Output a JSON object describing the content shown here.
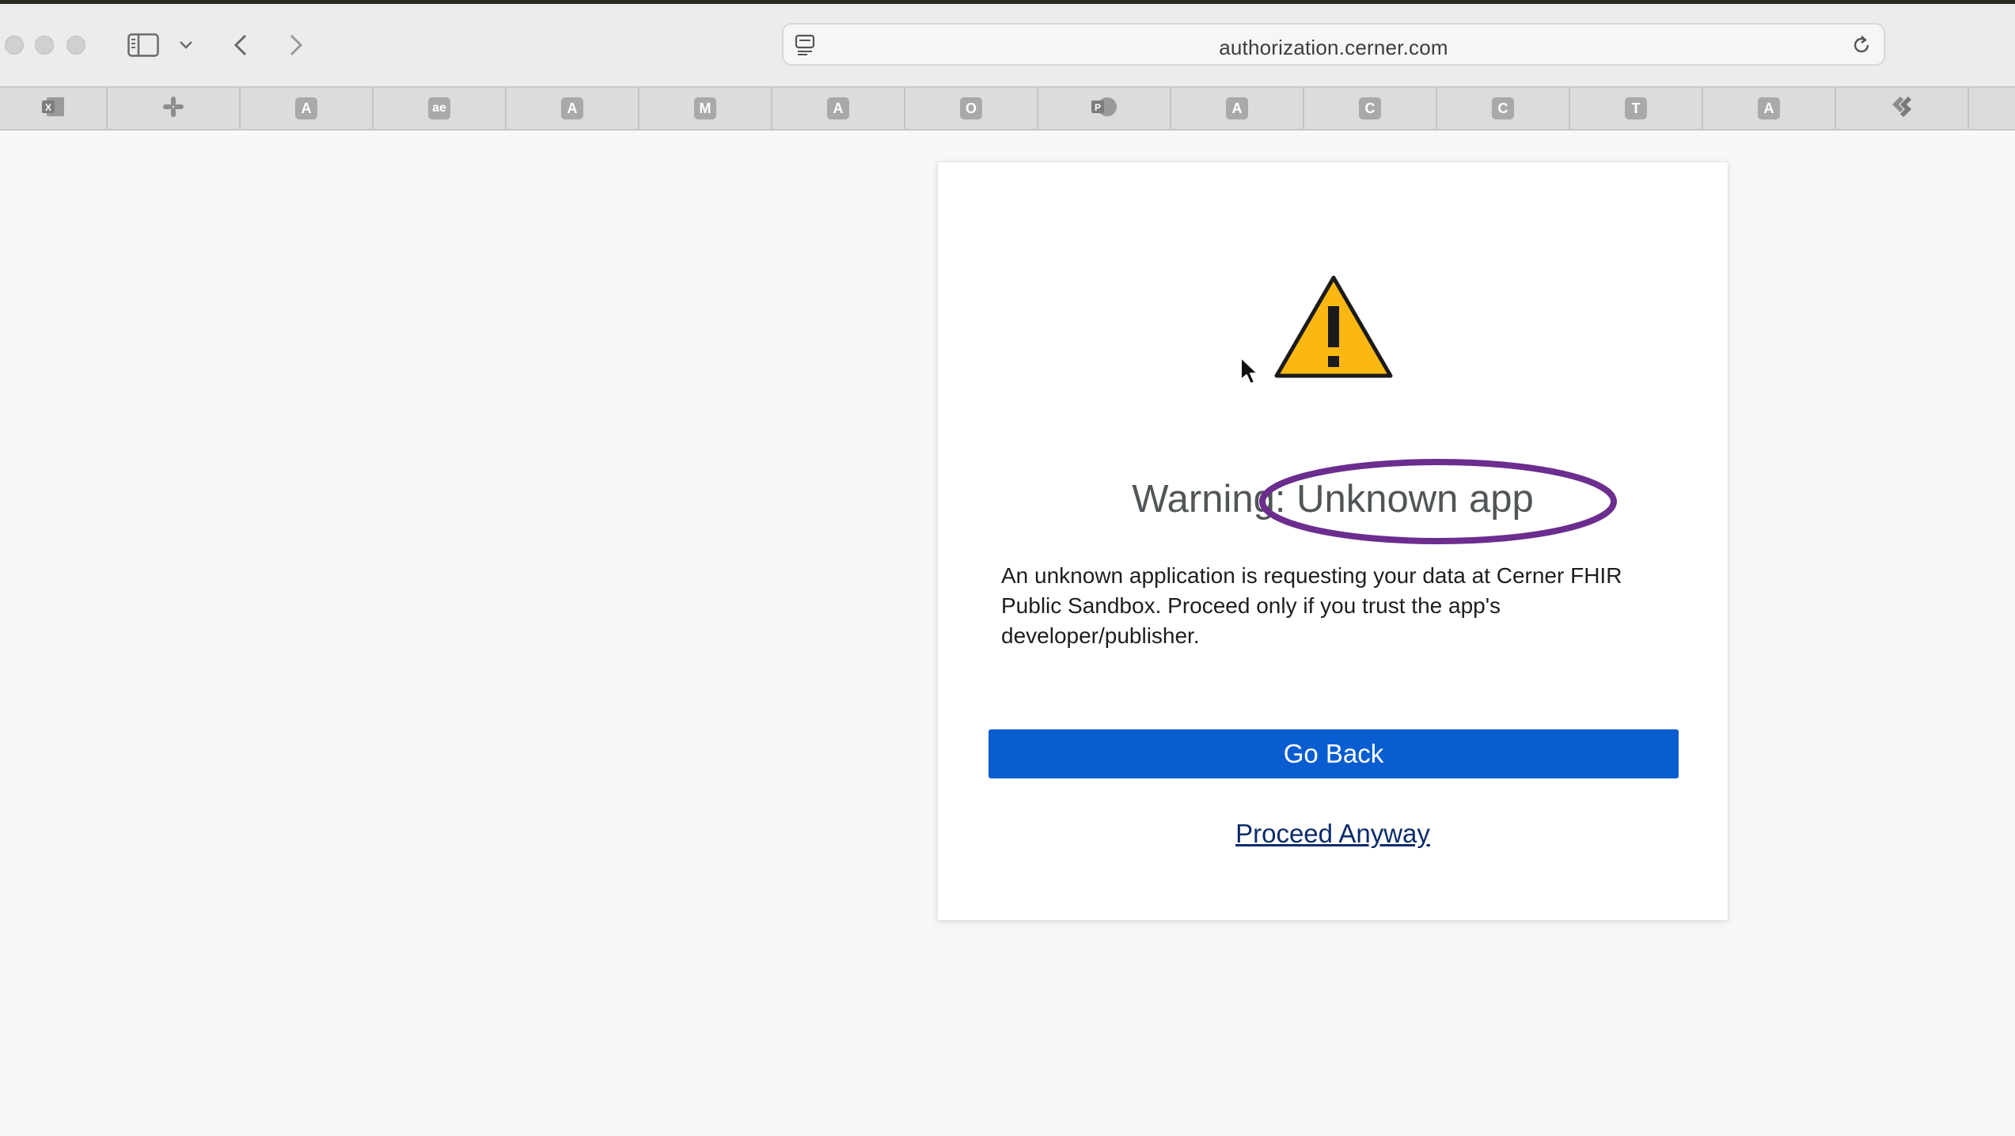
{
  "browser": {
    "url": "authorization.cerner.com",
    "icons": {
      "sidebar": "sidebar-icon",
      "dropdown": "chevron-down-icon",
      "back": "chevron-left-icon",
      "forward": "chevron-right-icon",
      "page_menu": "page-menu-icon",
      "reload": "reload-icon"
    }
  },
  "tabs": [
    {
      "letter": "",
      "icon": "excel-icon"
    },
    {
      "letter": "",
      "icon": "slack-icon"
    },
    {
      "letter": "A"
    },
    {
      "letter": "ae"
    },
    {
      "letter": "A"
    },
    {
      "letter": "M"
    },
    {
      "letter": "A"
    },
    {
      "letter": "O"
    },
    {
      "letter": "",
      "icon": "powerpoint-icon"
    },
    {
      "letter": "A"
    },
    {
      "letter": "C"
    },
    {
      "letter": "C"
    },
    {
      "letter": "T"
    },
    {
      "letter": "A"
    },
    {
      "letter": "",
      "icon": "jira-icon"
    }
  ],
  "dialog": {
    "icon": "warning-triangle-icon",
    "title": "Warning: Unknown app",
    "message": "An unknown application is requesting your data at Cerner FHIR Public Sandbox. Proceed only if you trust the app's developer/publisher.",
    "go_back_label": "Go Back",
    "proceed_label": "Proceed Anyway"
  },
  "colors": {
    "primary_button": "#0a5dd0",
    "warning_fill": "#fbb813",
    "annotation_oval": "#6b2d8e",
    "link": "#0c2b6b"
  }
}
